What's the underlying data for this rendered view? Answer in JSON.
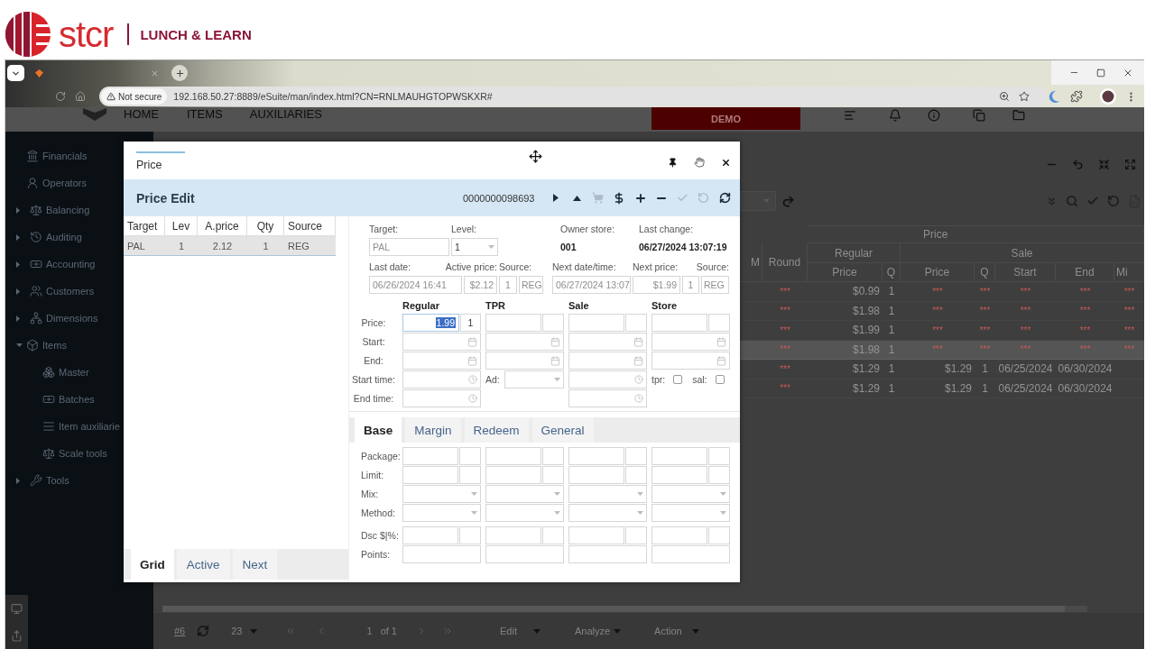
{
  "banner": {
    "brand": "stcr",
    "tagline": "LUNCH & LEARN"
  },
  "browser": {
    "security": "Not secure",
    "url": "192.168.50.27:8889/eSuite/man/index.html?CN=RNLMAUHGTOPWSKXR#"
  },
  "app_nav": {
    "links": [
      "HOME",
      "ITEMS",
      "AUXILIARIES"
    ],
    "demo": "DEMO"
  },
  "sidebar": [
    {
      "label": "Financials"
    },
    {
      "label": "Operators"
    },
    {
      "label": "Balancing",
      "expanded": false
    },
    {
      "label": "Auditing",
      "expanded": false
    },
    {
      "label": "Accounting",
      "expanded": false
    },
    {
      "label": "Customers",
      "expanded": false
    },
    {
      "label": "Dimensions",
      "expanded": false
    },
    {
      "label": "Items",
      "expanded": true,
      "children": [
        {
          "label": "Master"
        },
        {
          "label": "Batches"
        },
        {
          "label": "Item auxiliarie"
        },
        {
          "label": "Scale tools"
        }
      ]
    },
    {
      "label": "Tools",
      "expanded": false
    }
  ],
  "price_table": {
    "title": "Price",
    "left_columns": [
      "M",
      "Round"
    ],
    "groups": [
      {
        "label": "Regular",
        "columns": [
          "Price",
          "Q"
        ]
      },
      {
        "label": "Sale",
        "columns": [
          "Price",
          "Q",
          "Start",
          "End",
          "Mi"
        ]
      }
    ],
    "rows": [
      {
        "kind": "regular",
        "selected": false,
        "cells": [
          null,
          "***",
          "$0.99",
          "1",
          "***",
          "***",
          "***",
          "***",
          "***"
        ]
      },
      {
        "kind": "regular",
        "selected": false,
        "cells": [
          null,
          "***",
          "$1.98",
          "1",
          "***",
          "***",
          "***",
          "***",
          "***"
        ]
      },
      {
        "kind": "regular",
        "selected": false,
        "cells": [
          null,
          "***",
          "$1.99",
          "1",
          "***",
          "***",
          "***",
          "***",
          "***"
        ]
      },
      {
        "kind": "regular",
        "selected": true,
        "cells": [
          null,
          "***",
          "$1.98",
          "1",
          "***",
          "***",
          "***",
          "***",
          "***"
        ]
      },
      {
        "kind": "sale",
        "selected": false,
        "cells": [
          null,
          "***",
          "$1.29",
          "1",
          "$1.29",
          "1",
          "06/25/2024",
          "06/30/2024",
          null
        ]
      },
      {
        "kind": "sale",
        "selected": false,
        "cells": [
          null,
          "***",
          "$1.29",
          "1",
          "$1.29",
          "1",
          "06/25/2024",
          "06/30/2024",
          null
        ]
      }
    ]
  },
  "pager": {
    "record": "#6",
    "page_size": "23",
    "page": "1",
    "page_count": "of 1",
    "menus": [
      "Edit",
      "Analyze",
      "Action"
    ]
  },
  "dialog": {
    "tab": "Price",
    "title": "Price Edit",
    "record": "0000000098693",
    "tools": [
      {
        "disabled": false
      },
      {
        "disabled": false
      },
      {
        "disabled": true
      },
      {
        "disabled": false
      },
      {
        "disabled": false
      },
      {
        "disabled": false
      },
      {
        "disabled": true
      },
      {
        "disabled": true
      },
      {
        "disabled": false
      }
    ],
    "list": {
      "columns": [
        "Target",
        "Lev",
        "A.price",
        "Qty",
        "Source"
      ],
      "rows": [
        {
          "selected": true,
          "cells": [
            "PAL",
            "1",
            "2.12",
            "1",
            "REG"
          ]
        }
      ]
    },
    "list_tabs": [
      {
        "label": "Grid",
        "selected": true
      },
      {
        "label": "Active",
        "selected": false
      },
      {
        "label": "Next",
        "selected": false
      }
    ],
    "summary": {
      "target": {
        "label": "Target:",
        "value": "PAL"
      },
      "level": {
        "label": "Level:",
        "value": "1"
      },
      "owner_store": {
        "label": "Owner store:",
        "value": "001"
      },
      "last_change": {
        "label": "Last change:",
        "value": "06/27/2024 13:07:19"
      },
      "last_date": {
        "label": "Last date:",
        "value": "06/26/2024 16:41"
      },
      "active_price": {
        "label": "Active price:",
        "value": "$2.12"
      },
      "active_source": {
        "label": "Source:",
        "qty": "1",
        "code": "REG"
      },
      "next_date": {
        "label": "Next date/time:",
        "value": "06/27/2024 13:07"
      },
      "next_price": {
        "label": "Next price:",
        "value": "$1.99"
      },
      "next_source": {
        "label": "Source:",
        "qty": "1",
        "code": "REG"
      }
    },
    "price_columns": [
      "Regular",
      "TPR",
      "Sale",
      "Store"
    ],
    "price_rows": [
      {
        "label": "Price:",
        "kind": "price"
      },
      {
        "label": "Start:",
        "kind": "date"
      },
      {
        "label": "End:",
        "kind": "date"
      },
      {
        "label": "Start time:",
        "kind": "start_time"
      },
      {
        "label": "End time:",
        "kind": "end_time"
      }
    ],
    "regular_price": {
      "value": "1.99",
      "highlighted": true,
      "qty": "1"
    },
    "ad": {
      "label": "Ad:"
    },
    "flags": [
      {
        "label": "tpr:",
        "checked": false
      },
      {
        "label": "sal:",
        "checked": false
      }
    ],
    "detail_tabs": [
      {
        "label": "Base",
        "selected": true
      },
      {
        "label": "Margin",
        "selected": false
      },
      {
        "label": "Redeem",
        "selected": false
      },
      {
        "label": "General",
        "selected": false
      }
    ],
    "detail_rows": [
      {
        "label": "Package:",
        "kind": "pair"
      },
      {
        "label": "Limit:",
        "kind": "pair"
      },
      {
        "label": "Mix:",
        "kind": "select"
      },
      {
        "label": "Method:",
        "kind": "select"
      },
      {
        "label": "Dsc $|%:",
        "kind": "pair"
      },
      {
        "label": "Points:",
        "kind": "single"
      }
    ]
  }
}
